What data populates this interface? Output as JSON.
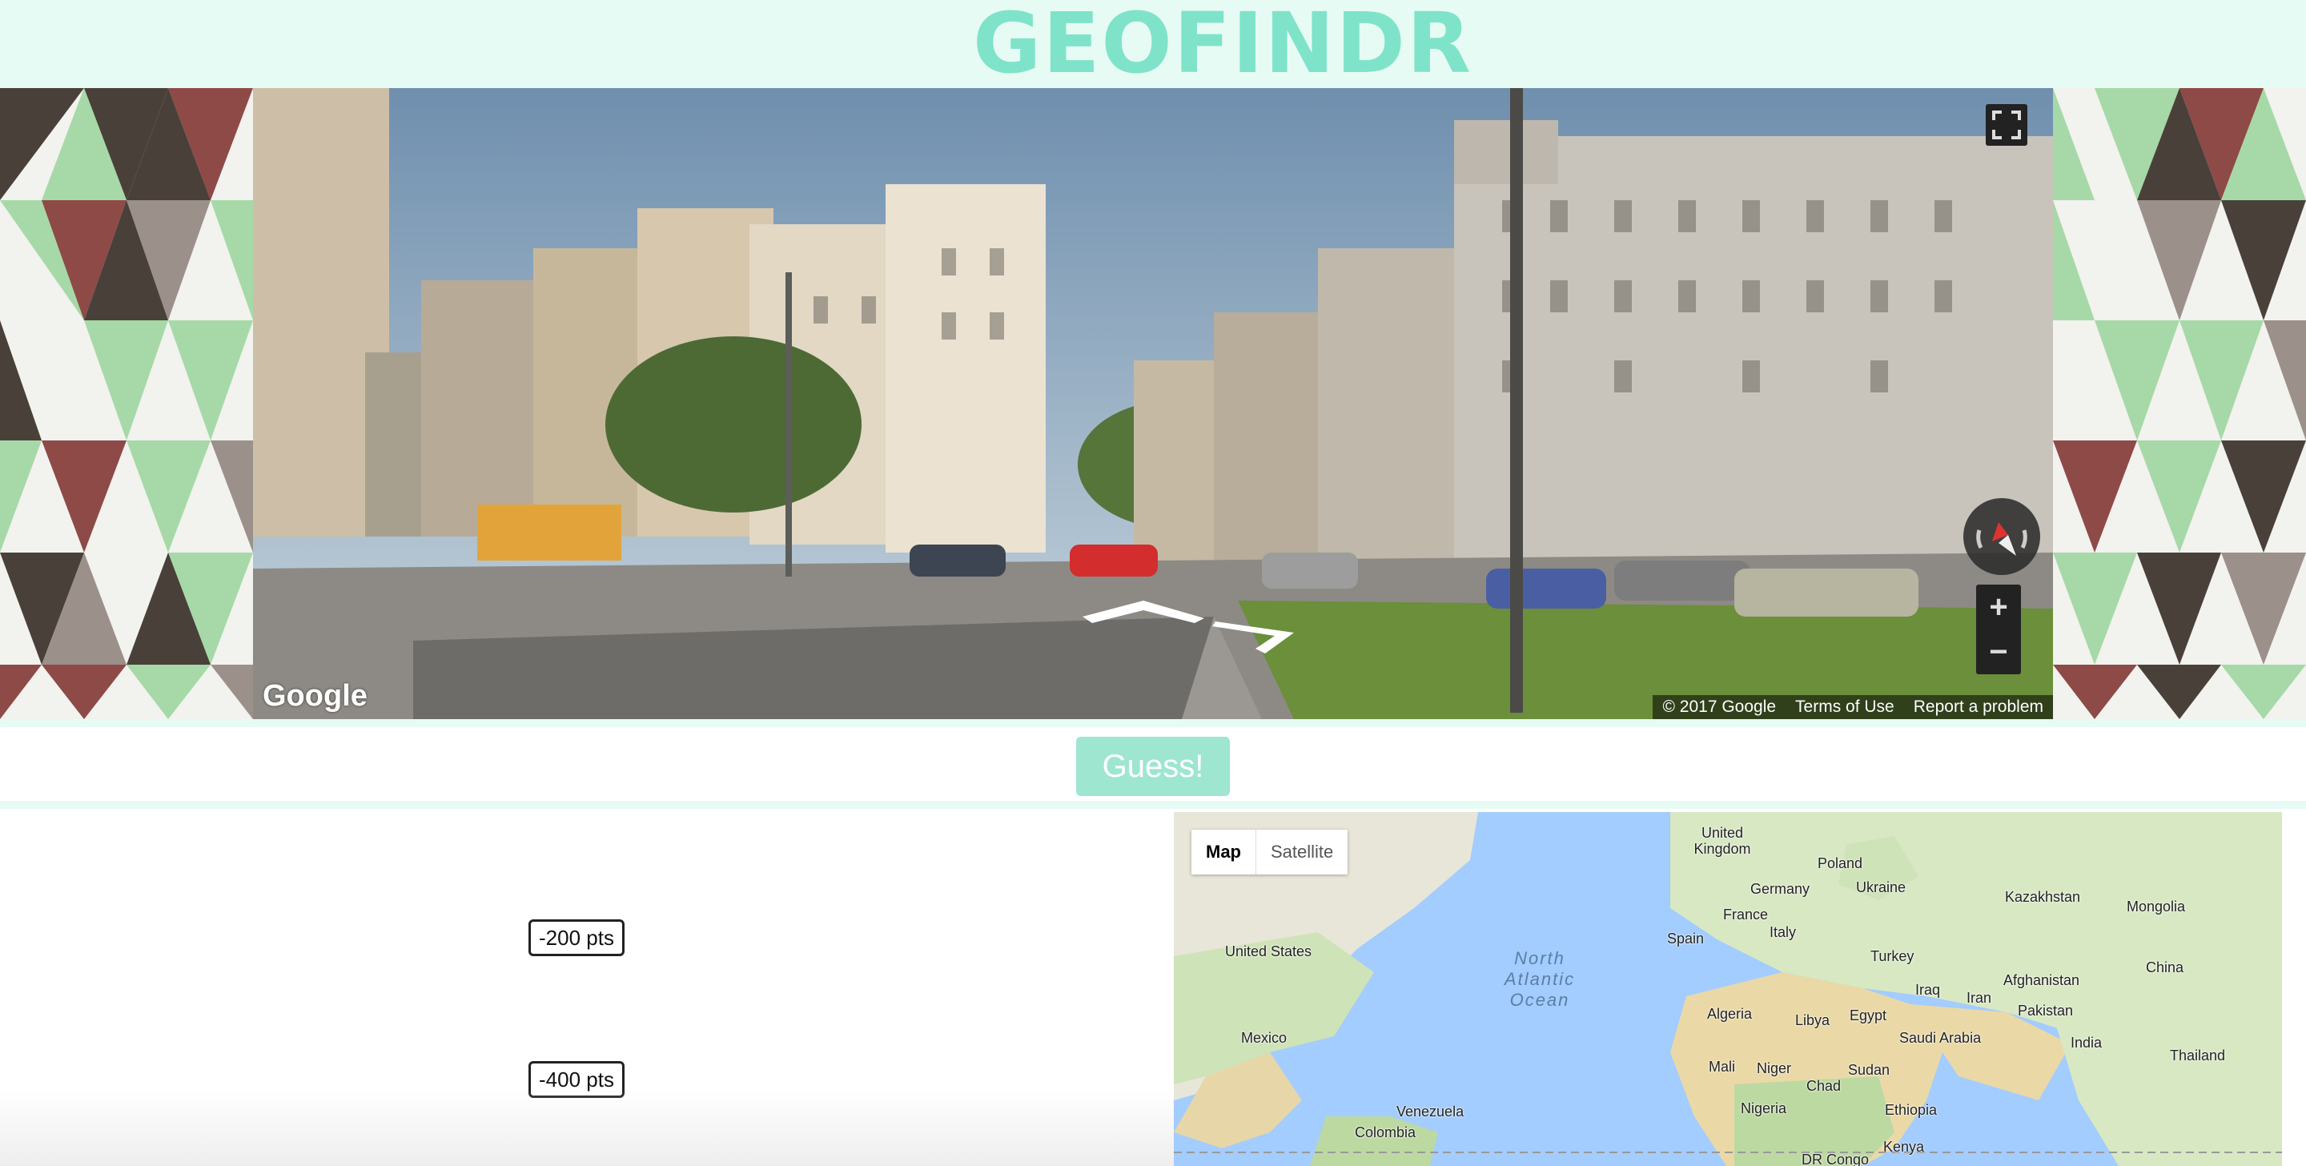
{
  "header": {
    "logo": "GEOFINDR"
  },
  "streetview": {
    "logo": "Google",
    "copyright": "© 2017 Google",
    "terms": "Terms of Use",
    "report": "Report a problem",
    "zoom_in": "+",
    "zoom_out": "−"
  },
  "guess_label": "Guess!",
  "penalties": [
    "-200 pts",
    "-400 pts"
  ],
  "map": {
    "types": [
      "Map",
      "Satellite"
    ],
    "selected_type": "Map",
    "labels": {
      "uk": "United Kingdom",
      "poland": "Poland",
      "germany": "Germany",
      "ukraine": "Ukraine",
      "kazakhstan": "Kazakhstan",
      "mongolia": "Mongolia",
      "france": "France",
      "spain": "Spain",
      "italy": "Italy",
      "turkey": "Turkey",
      "china": "China",
      "us": "United States",
      "afghanistan": "Afghanistan",
      "iraq": "Iraq",
      "iran": "Iran",
      "pakistan": "Pakistan",
      "algeria": "Algeria",
      "libya": "Libya",
      "egypt": "Egypt",
      "saudi": "Saudi Arabia",
      "india": "India",
      "mexico": "Mexico",
      "thailand": "Thailand",
      "mali": "Mali",
      "niger": "Niger",
      "sudan": "Sudan",
      "chad": "Chad",
      "venezuela": "Venezuela",
      "nigeria": "Nigeria",
      "ethiopia": "Ethiopia",
      "colombia": "Colombia",
      "kenya": "Kenya",
      "drc": "DR Congo",
      "ocean": "North Atlantic Ocean"
    }
  },
  "colors": {
    "mint": "#7fe3c9",
    "mint_light": "#e6fbf4",
    "button": "#9ee6cf",
    "pattern_brown": "#8e4a47",
    "pattern_dark": "#4a403a",
    "pattern_green": "#a6d9a7",
    "pattern_grey": "#9c908a"
  },
  "icons": [
    "fullscreen-icon",
    "compass-icon",
    "move-arrow-icon"
  ]
}
